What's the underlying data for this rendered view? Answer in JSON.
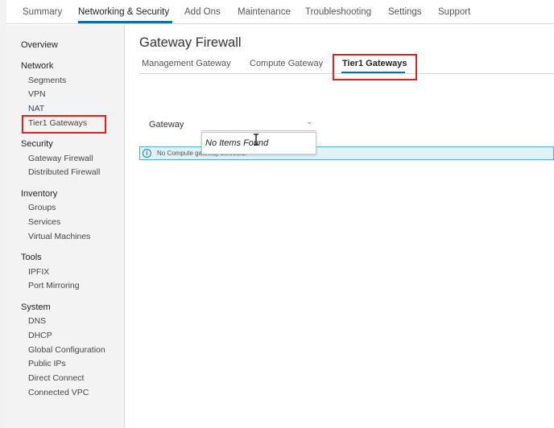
{
  "topnav": {
    "tabs": [
      "Summary",
      "Networking & Security",
      "Add Ons",
      "Maintenance",
      "Troubleshooting",
      "Settings",
      "Support"
    ],
    "active": "Networking & Security"
  },
  "sidebar": {
    "overview": "Overview",
    "sections": [
      {
        "title": "Network",
        "items": [
          "Segments",
          "VPN",
          "NAT",
          "Tier1 Gateways"
        ]
      },
      {
        "title": "Security",
        "items": [
          "Gateway Firewall",
          "Distributed Firewall"
        ]
      },
      {
        "title": "Inventory",
        "items": [
          "Groups",
          "Services",
          "Virtual Machines"
        ]
      },
      {
        "title": "Tools",
        "items": [
          "IPFIX",
          "Port Mirroring"
        ]
      },
      {
        "title": "System",
        "items": [
          "DNS",
          "DHCP",
          "Global Configuration",
          "Public IPs",
          "Direct Connect",
          "Connected VPC"
        ]
      }
    ]
  },
  "main": {
    "title": "Gateway Firewall",
    "subtabs": [
      "Management Gateway",
      "Compute Gateway",
      "Tier1 Gateways"
    ],
    "active_subtab": "Tier1 Gateways",
    "gateway_label": "Gateway",
    "dropdown_empty": "No Items Found",
    "info_message": "No Compute gateway selected."
  },
  "colors": {
    "accent": "#0072a3",
    "highlight": "#e01f1f",
    "info_bg": "#e1f1f6"
  }
}
